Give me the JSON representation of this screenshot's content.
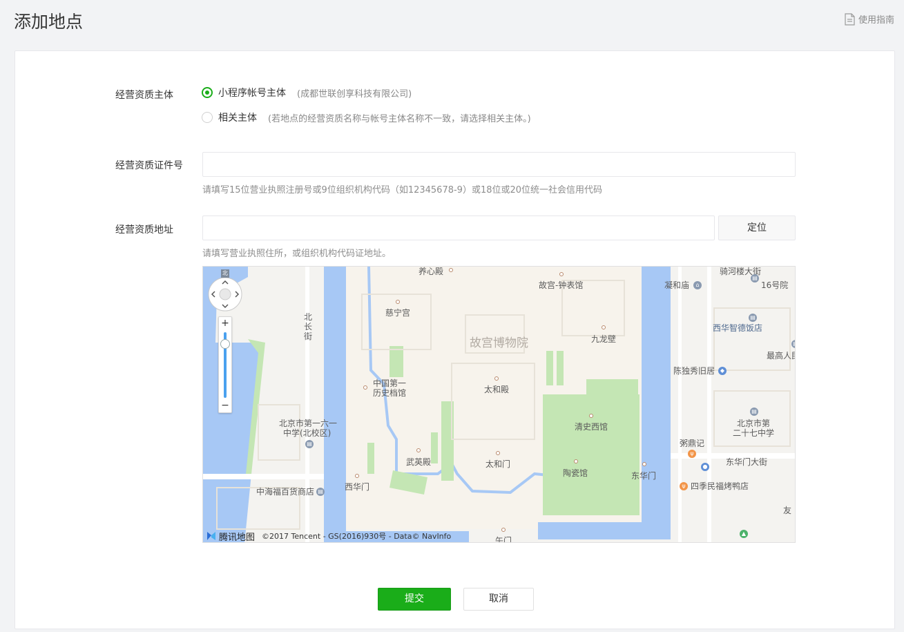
{
  "header": {
    "title": "添加地点",
    "guide_link": "使用指南"
  },
  "form": {
    "entity": {
      "label": "经营资质主体",
      "options": [
        {
          "label": "小程序帐号主体",
          "note": "(成都世联创享科技有限公司)",
          "checked": true
        },
        {
          "label": "相关主体",
          "note": "(若地点的经营资质名称与帐号主体名称不一致，请选择相关主体。)",
          "checked": false
        }
      ]
    },
    "license": {
      "label": "经营资质证件号",
      "value": "",
      "placeholder": "",
      "hint": "请填写15位营业执照注册号或9位组织机构代码（如12345678-9）或18位或20位统一社会信用代码"
    },
    "address": {
      "label": "经营资质地址",
      "value": "",
      "placeholder": "",
      "locate_button": "定位",
      "hint": "请填写营业执照住所，或组织机构代码证地址。"
    }
  },
  "map": {
    "pois": {
      "yangxin": "养心殿",
      "zhongbiao": "故宫-钟表馆",
      "ninghe": "凝和庙",
      "qilou": "骑河楼大街",
      "qilou16": "16号院",
      "cining": "慈宁宫",
      "palace": "故宫博物院",
      "jiulong": "九龙壁",
      "xihua_hotel": "西华智德饭店",
      "zuigao": "最高人民",
      "beichang": "北长街",
      "archives1": "中国第一",
      "archives2": "历史档馆",
      "taihedian": "太和殿",
      "chenduxiu": "陈独秀旧居",
      "school161_1": "北京市第一六一",
      "school161_2": "中学(北校区)",
      "qingshi": "清史西馆",
      "school27_1": "北京市第",
      "school27_2": "二十七中学",
      "zhouding": "粥鼎记",
      "wuying": "武英殿",
      "taihemen": "太和门",
      "donghuamen_st": "东华门大街",
      "taoci": "陶瓷馆",
      "donghuamen": "东华门",
      "zhonghai": "中海福百货商店",
      "xihuamen": "西华门",
      "siji": "四季民福烤鸭店",
      "youai": "友",
      "wumen": "午门",
      "north": "北"
    },
    "logo_text": "腾讯地图",
    "copyright": "©2017 Tencent - GS(2016)930号 - Data© NavInfo",
    "zoom_in": "+",
    "zoom_out": "−",
    "zoom_level": 0.88
  },
  "actions": {
    "submit": "提交",
    "cancel": "取消"
  },
  "colors": {
    "primary": "#1aad19",
    "water": "#a7c8f5",
    "park": "#c4e6b4"
  }
}
